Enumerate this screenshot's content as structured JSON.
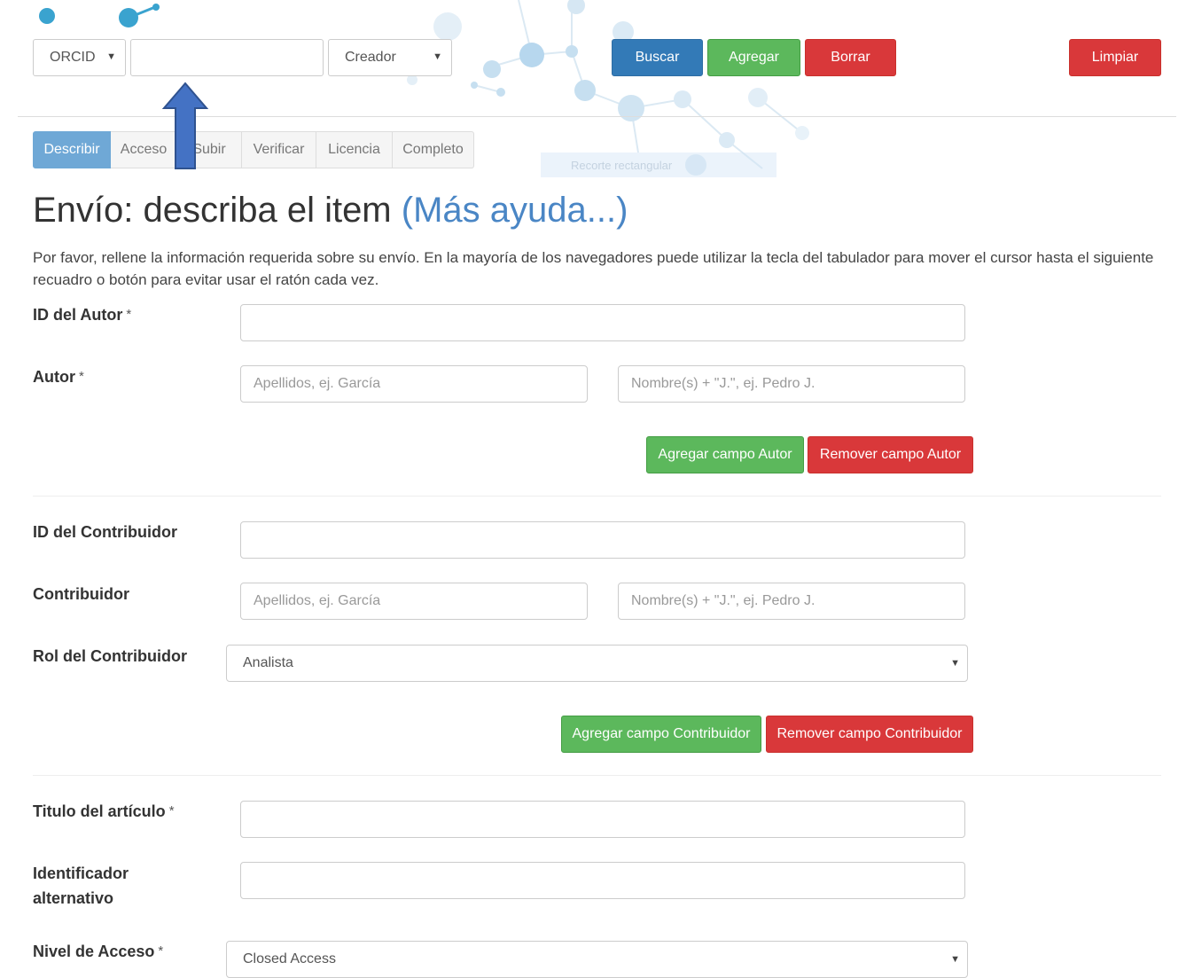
{
  "topbar": {
    "id_type_select": "ORCID",
    "search_input_value": "",
    "role_select": "Creador",
    "search_button": "Buscar",
    "add_button": "Agregar",
    "delete_button": "Borrar",
    "clear_button": "Limpiar"
  },
  "snip_tooltip": "Recorte rectangular",
  "tabs": [
    {
      "label": "Describir",
      "active": true
    },
    {
      "label": "Acceso"
    },
    {
      "label": "Subir"
    },
    {
      "label": "Verificar"
    },
    {
      "label": "Licencia"
    },
    {
      "label": "Completo"
    }
  ],
  "page": {
    "title": "Envío: describa el item",
    "help_link": "(Más ayuda...)",
    "intro": "Por favor, rellene la información requerida sobre su envío. En la mayoría de los navegadores puede utilizar la tecla del tabulador para mover el cursor hasta el siguiente recuadro o botón para evitar usar el ratón cada vez."
  },
  "form": {
    "required_mark": "*",
    "author_id": {
      "label": "ID del Autor",
      "value": ""
    },
    "author": {
      "label": "Autor",
      "last_name_placeholder": "Apellidos, ej. García",
      "first_name_placeholder": "Nombre(s) + \"J.\",  ej. Pedro J.",
      "add_button": "Agregar campo Autor",
      "remove_button": "Remover campo Autor"
    },
    "contributor_id": {
      "label": "ID del Contribuidor",
      "value": ""
    },
    "contributor": {
      "label": "Contribuidor",
      "last_name_placeholder": "Apellidos, ej. García",
      "first_name_placeholder": "Nombre(s) + \"J.\",  ej. Pedro J."
    },
    "contributor_role": {
      "label": "Rol del Contribuidor",
      "selected": "Analista",
      "add_button": "Agregar campo Contribuidor",
      "remove_button": "Remover campo Contribuidor"
    },
    "article_title": {
      "label": "Titulo del artículo",
      "value": ""
    },
    "alt_identifier": {
      "label_line1": "Identificador",
      "label_line2": "alternativo",
      "value": ""
    },
    "access_level": {
      "label": "Nivel de Acceso",
      "selected": "Closed Access"
    }
  },
  "colors": {
    "primary": "#337ab7",
    "success": "#5cb85c",
    "danger": "#d9383a",
    "active_tab": "#6fa8d6",
    "arrow": "#4472c4"
  },
  "icons": {
    "dropdown": "caret-down-icon",
    "annotation": "arrow-up-icon"
  },
  "caret_glyph": "▼"
}
